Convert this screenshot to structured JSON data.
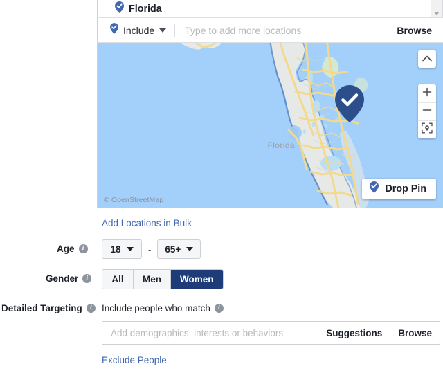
{
  "location_section": {
    "selected_chip": {
      "label": "Florida",
      "icon": "map-pin-check-icon"
    },
    "scroll_arrow_icon": "chevron-down-icon",
    "include_dropdown": {
      "label": "Include",
      "icon": "map-pin-check-icon",
      "caret_icon": "caret-down-icon"
    },
    "location_input": {
      "value": "",
      "placeholder": "Type to add more locations"
    },
    "browse_label": "Browse",
    "bulk_link_label": "Add Locations in Bulk"
  },
  "map": {
    "region_label": "Florida",
    "attribution": "© OpenStreetMap",
    "marker_icon": "map-pin-check-icon",
    "controls": {
      "collapse_icon": "chevron-up-icon",
      "zoom_in_icon": "plus-icon",
      "zoom_out_icon": "minus-icon",
      "locate_icon": "locate-pin-icon"
    },
    "drop_pin_button": {
      "label": "Drop Pin",
      "icon": "map-pin-check-icon"
    },
    "colors": {
      "water": "#a3d0fa",
      "land": "#e7e9e7",
      "road": "#f3d98c",
      "marker": "#2c4f8c",
      "lake": "#b9def5"
    }
  },
  "age": {
    "label": "Age",
    "info_icon": "info-icon",
    "min_value": "18",
    "max_value": "65+",
    "separator": "-",
    "caret_icon": "caret-down-icon"
  },
  "gender": {
    "label": "Gender",
    "info_icon": "info-icon",
    "options": [
      {
        "label": "All",
        "selected": false
      },
      {
        "label": "Men",
        "selected": false
      },
      {
        "label": "Women",
        "selected": true
      }
    ],
    "selected_color": "#1d3c78"
  },
  "detailed_targeting": {
    "label": "Detailed Targeting",
    "info_icon": "info-icon",
    "subheading": "Include people who match",
    "subheading_info_icon": "info-icon",
    "input": {
      "value": "",
      "placeholder": "Add demographics, interests or behaviors"
    },
    "suggestions_label": "Suggestions",
    "browse_label": "Browse",
    "exclude_link_label": "Exclude People"
  },
  "theme": {
    "link_color": "#4267b2",
    "text_color": "#1d2129",
    "border_color": "#ccd0d5"
  }
}
